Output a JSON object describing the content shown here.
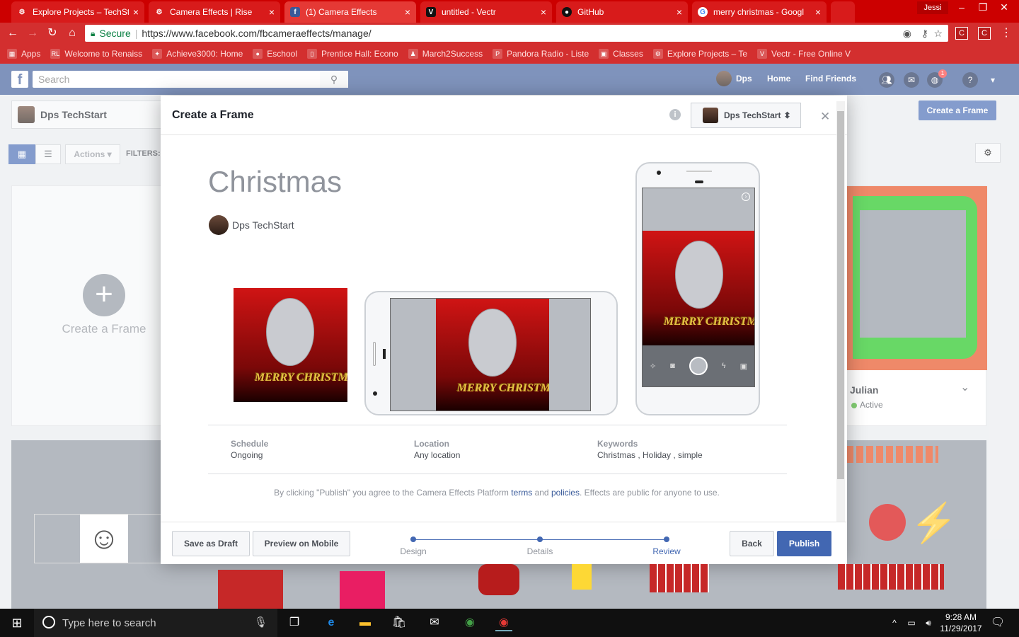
{
  "browser": {
    "tabs": [
      {
        "title": "Explore Projects – TechSt",
        "icon": "project-icon"
      },
      {
        "title": "Camera Effects | Rise",
        "icon": "project-icon"
      },
      {
        "title": "(1) Camera Effects",
        "icon": "facebook-icon",
        "active": true
      },
      {
        "title": "untitled - Vectr",
        "icon": "vectr-icon"
      },
      {
        "title": "GitHub",
        "icon": "github-icon"
      },
      {
        "title": "merry christmas - Googl",
        "icon": "google-icon"
      }
    ],
    "user": "Jessi",
    "secure_label": "Secure",
    "url": "https://www.facebook.com/fbcameraeffects/manage/",
    "bookmarks": [
      "Apps",
      "Welcome to Renaiss",
      "Achieve3000: Home",
      "Eschool",
      "Prentice Hall: Econo",
      "March2Success",
      "Pandora Radio - Liste",
      "Classes",
      "Explore Projects – Te",
      "Vectr - Free Online V"
    ]
  },
  "fb": {
    "search_placeholder": "Search",
    "profile_name": "Dps",
    "nav_home": "Home",
    "nav_find_friends": "Find Friends",
    "notification_count": "1"
  },
  "background": {
    "page_name": "Dps TechStart",
    "create_button": "Create a Frame",
    "actions_label": "Actions",
    "filters_label": "FILTERS:",
    "create_card_label": "Create a Frame",
    "julian_name": "Julian",
    "julian_status": "Active"
  },
  "modal": {
    "title": "Create a Frame",
    "page_selector": "Dps TechStart",
    "frame_title": "Christmas",
    "owner": "Dps TechStart",
    "frame_text": "MERRY CHRISTMAS",
    "schedule_label": "Schedule",
    "schedule_value": "Ongoing",
    "location_label": "Location",
    "location_value": "Any location",
    "keywords_label": "Keywords",
    "keywords_value": "Christmas , Holiday , simple",
    "agreement_prefix": "By clicking \"Publish\" you agree to the Camera Effects Platform",
    "agreement_terms": "terms",
    "agreement_and": "and",
    "agreement_policies": "policies",
    "agreement_suffix": ". Effects are public for anyone to use.",
    "save_draft": "Save as Draft",
    "preview_mobile": "Preview on Mobile",
    "steps": [
      "Design",
      "Details",
      "Review"
    ],
    "active_step": "Review",
    "back": "Back",
    "publish": "Publish"
  },
  "taskbar": {
    "search_placeholder": "Type here to search",
    "time": "9:28 AM",
    "date": "11/29/2017"
  },
  "colors": {
    "chrome_red": "#cc0000",
    "facebook_blue": "#3b5998",
    "button_blue": "#4267b2",
    "frame_red": "#d01414"
  }
}
